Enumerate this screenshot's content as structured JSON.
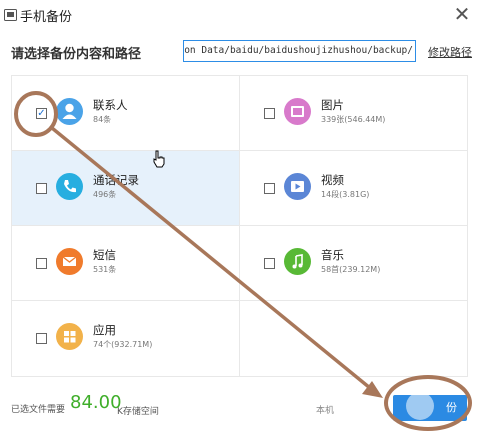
{
  "window": {
    "title": "手机备份"
  },
  "path": {
    "label": "请选择备份内容和路径",
    "value": "lication Data/baidu/baidushoujizhushou/backup/",
    "edit_label": "修改路径"
  },
  "items": [
    {
      "name": "联系人",
      "count": "84条",
      "checked": true,
      "icon": "contacts-icon",
      "color": "#4aa3e8"
    },
    {
      "name": "图片",
      "count": "339张(546.44M)",
      "checked": false,
      "icon": "pictures-icon",
      "color": "#d87acb"
    },
    {
      "name": "通话记录",
      "count": "496条",
      "checked": false,
      "icon": "call-log-icon",
      "color": "#27aee0"
    },
    {
      "name": "视频",
      "count": "14段(3.81G)",
      "checked": false,
      "icon": "video-icon",
      "color": "#5b86d6"
    },
    {
      "name": "短信",
      "count": "531条",
      "checked": false,
      "icon": "sms-icon",
      "color": "#f07b2c"
    },
    {
      "name": "音乐",
      "count": "58首(239.12M)",
      "checked": false,
      "icon": "music-icon",
      "color": "#58b936"
    },
    {
      "name": "应用",
      "count": "74个(932.71M)",
      "checked": false,
      "icon": "apps-icon",
      "color": "#f2b24a"
    }
  ],
  "footer": {
    "prefix": "已选文件需要",
    "size_value": "84.00",
    "suffix": "K存储空间",
    "local_label": "本机",
    "start_label": "份"
  },
  "colors": {
    "accent": "#2b8ae3",
    "size_green": "#3fae2a",
    "annotation": "#a8775a"
  }
}
